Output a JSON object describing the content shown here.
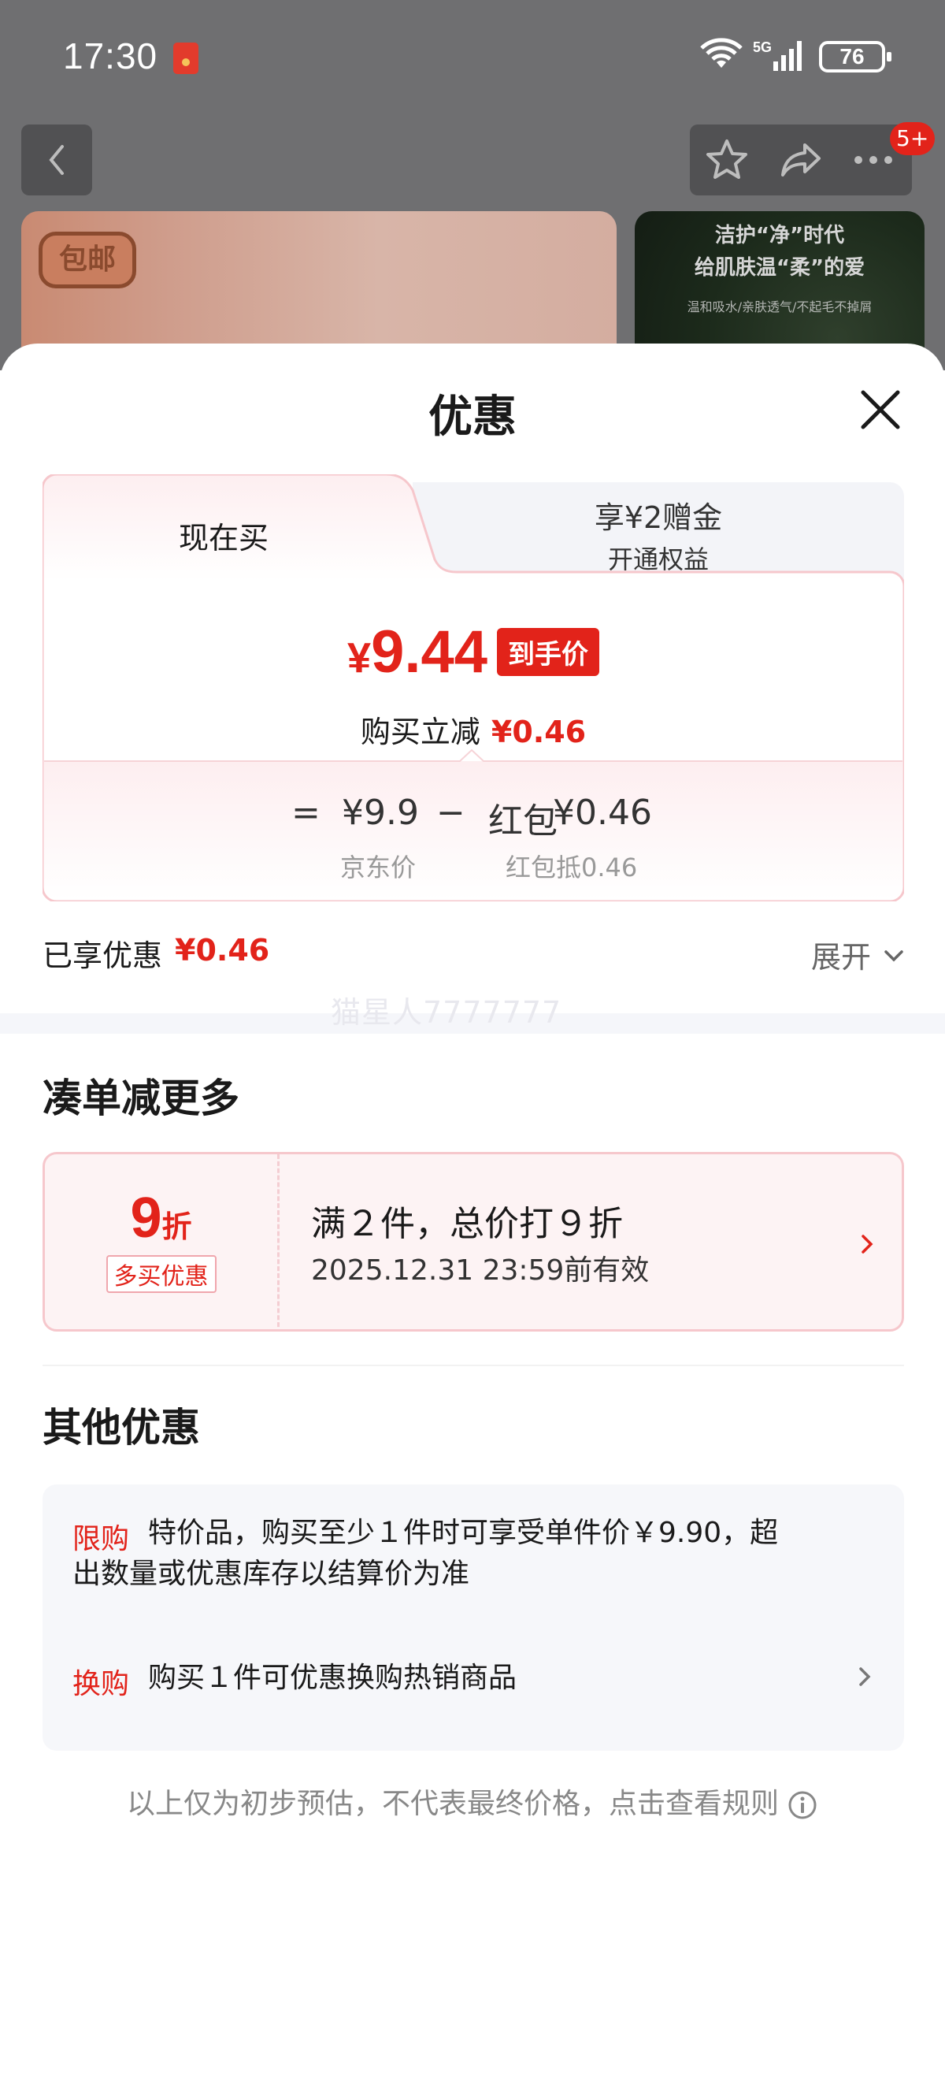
{
  "status_bar": {
    "time": "17:30",
    "battery": "76"
  },
  "nav": {
    "badge": "5+"
  },
  "hero": {
    "left_badge": "包邮",
    "right_line1": "洁护“净”时代",
    "right_line2": "给肌肤温“柔”的爱",
    "right_line3": "温和吸水/亲肤透气/不起毛不掉屑"
  },
  "sheet": {
    "title": "优惠"
  },
  "tabs": [
    {
      "label": "现在买",
      "active": true
    },
    {
      "label": "享¥2赠金",
      "sublabel": "开通权益",
      "active": false
    }
  ],
  "price": {
    "symbol": "¥",
    "value": "9.44",
    "tag": "到手价",
    "reduce_label": "购买立减",
    "reduce_value": "¥0.46"
  },
  "formula": {
    "equals": "=",
    "base": "¥9.9",
    "minus": "−",
    "deduct_label": "红包",
    "deduct_value": "¥0.46",
    "base_caption": "京东价",
    "deduct_caption": "红包抵0.46"
  },
  "enjoyed": {
    "label": "已享优惠",
    "value": "¥0.46",
    "expand": "展开"
  },
  "watermark": "猫星人7777777",
  "more_section": {
    "title": "凑单减更多",
    "coupon": {
      "discount_number": "9",
      "discount_unit": "折",
      "tag": "多买优惠",
      "title": "满２件，总价打９折",
      "validity": "2025.12.31 23:59前有效"
    }
  },
  "other_section": {
    "title": "其他优惠",
    "items": [
      {
        "tag": "限购",
        "text_line1": "特价品，购买至少１件时可享受单件价￥9.90，超",
        "text_line2": "出数量或优惠库存以结算价为准"
      },
      {
        "tag": "换购",
        "text_line1": "购买１件可优惠换购热销商品"
      }
    ]
  },
  "footer_note": "以上仅为初步预估，不代表最终价格，点击查看规则",
  "colors": {
    "accent_red": "#e2231a",
    "pink_border": "#f6c7cc",
    "dim_overlay": "#6f6f71"
  }
}
